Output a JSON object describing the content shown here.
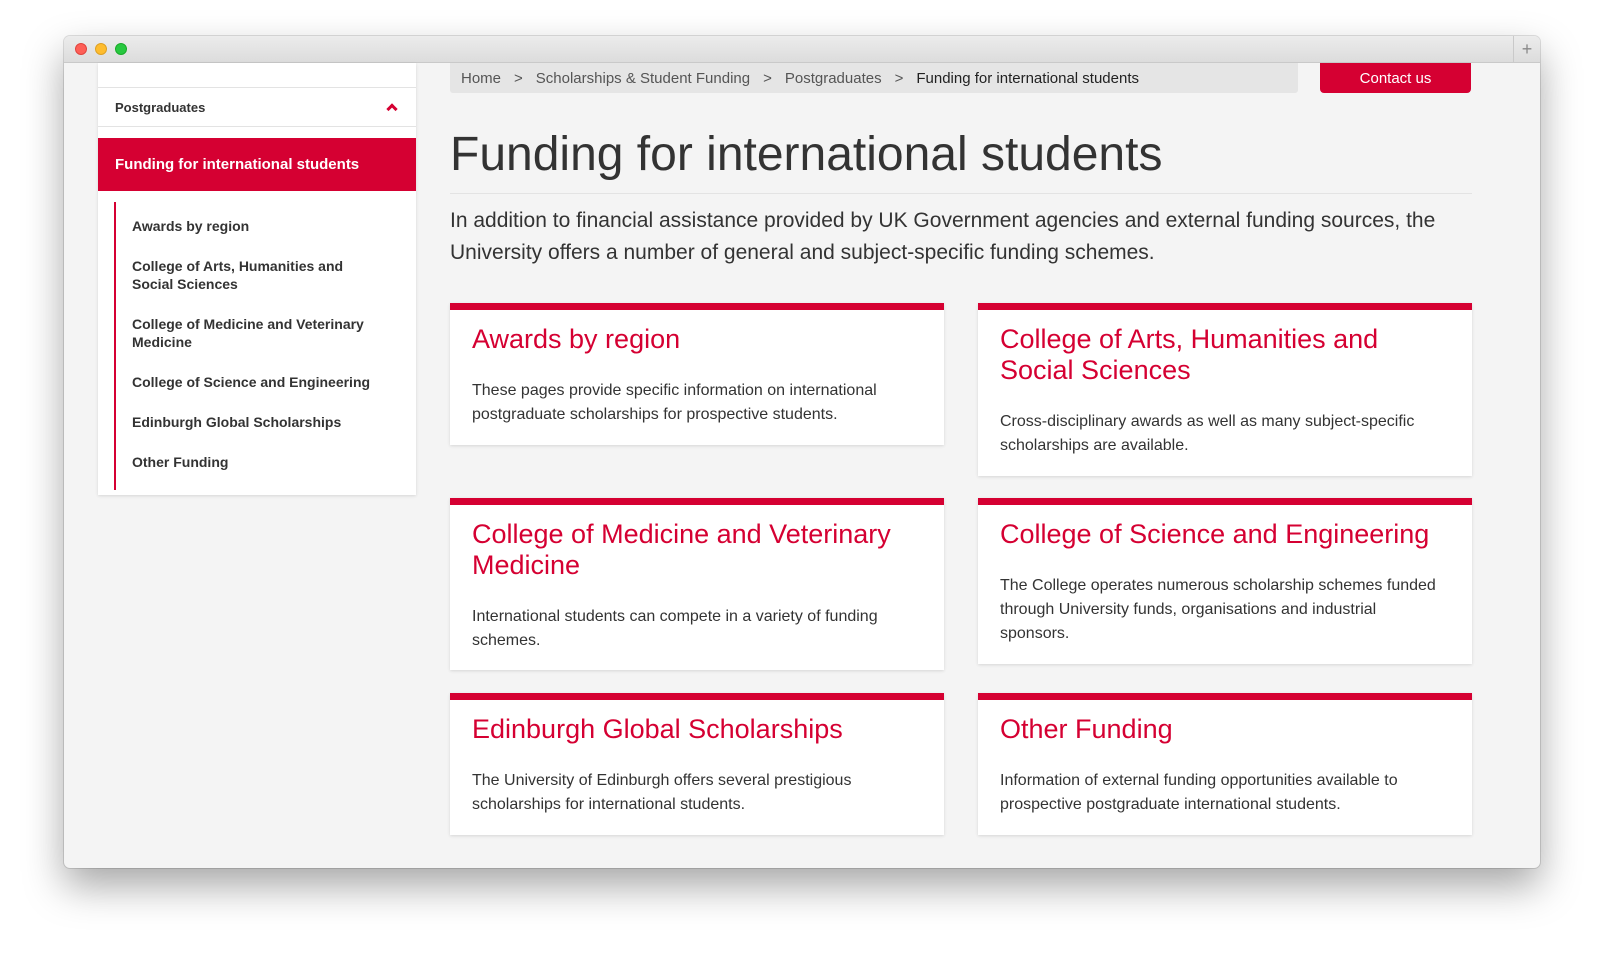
{
  "breadcrumb": {
    "items": [
      "Home",
      "Scholarships & Student Funding",
      "Postgraduates"
    ],
    "current": "Funding for international students",
    "separator": ">"
  },
  "header": {
    "contact_label": "Contact us"
  },
  "sidebar": {
    "parent_label": "Postgraduates",
    "active_label": "Funding for international students",
    "children": [
      "Awards by region",
      "College of Arts, Humanities and Social Sciences",
      "College of Medicine and Veterinary Medicine",
      "College of Science and Engineering",
      "Edinburgh Global Scholarships",
      "Other Funding"
    ]
  },
  "main": {
    "title": "Funding for international students",
    "intro": "In addition to financial assistance provided by UK Government agencies and external funding sources, the University offers a number of general and subject-specific funding schemes.",
    "cards": [
      {
        "title": "Awards by region",
        "text": "These pages provide specific information on international postgraduate scholarships for prospective students."
      },
      {
        "title": "College of Arts, Humanities and Social Sciences",
        "text": "Cross-disciplinary awards as well as many subject-specific scholarships are available."
      },
      {
        "title": "College of Medicine and Veterinary Medicine",
        "text": "International students can compete in a variety of funding schemes."
      },
      {
        "title": "College of Science and Engineering",
        "text": "The College operates numerous scholarship schemes funded through University funds, organisations and industrial sponsors."
      },
      {
        "title": "Edinburgh Global Scholarships",
        "text": "The University of Edinburgh offers several prestigious scholarships for international students."
      },
      {
        "title": "Other Funding",
        "text": "Information of external funding opportunities available to prospective postgraduate international students."
      }
    ]
  },
  "colors": {
    "accent": "#d50032",
    "background": "#f4f4f4",
    "text": "#333333"
  },
  "window": {
    "new_tab_icon": "+"
  }
}
